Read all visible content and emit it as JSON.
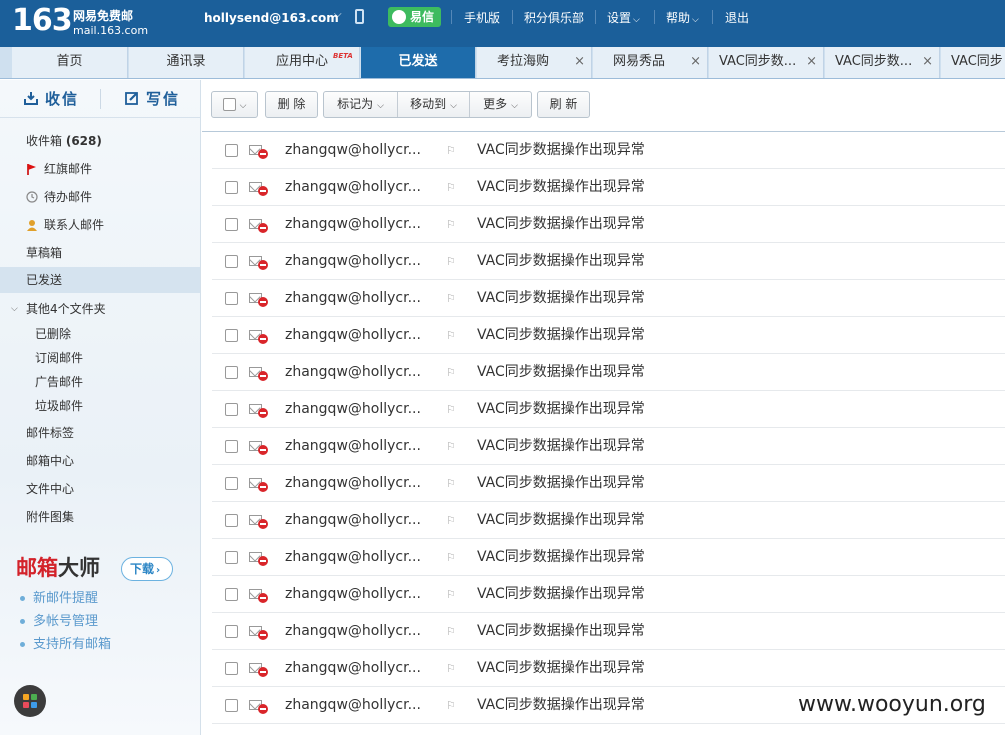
{
  "brand": {
    "logo_number": "163",
    "name": "网易免费邮",
    "domain": "mail.163.com"
  },
  "topbar": {
    "account": "hollysend@163.com",
    "yixin": "易信",
    "links": [
      "手机版",
      "积分俱乐部",
      "设置",
      "帮助",
      "退出"
    ]
  },
  "tabs": [
    {
      "label": "首页"
    },
    {
      "label": "通讯录"
    },
    {
      "label": "应用中心",
      "badge": "BETA"
    },
    {
      "label": "已发送",
      "active": true
    },
    {
      "label": "考拉海购"
    },
    {
      "label": "网易秀品"
    },
    {
      "label": "VAC同步数..."
    },
    {
      "label": "VAC同步数..."
    },
    {
      "label": "VAC同步"
    }
  ],
  "sidebar": {
    "receive": "收信",
    "compose": "写信",
    "inbox_label": "收件箱",
    "inbox_count": "(628)",
    "folders": [
      "红旗邮件",
      "待办邮件",
      "联系人邮件",
      "草稿箱",
      "已发送"
    ],
    "other_folders": "其他4个文件夹",
    "sub_folders": [
      "已删除",
      "订阅邮件",
      "广告邮件",
      "垃圾邮件"
    ],
    "extras": [
      "邮件标签",
      "邮箱中心",
      "文件中心",
      "附件图集"
    ],
    "promo": {
      "title_red": "邮箱",
      "title_dark": "大师",
      "download": "下载",
      "features": [
        "新邮件提醒",
        "多帐号管理",
        "支持所有邮箱"
      ]
    }
  },
  "toolbar": {
    "delete": "删 除",
    "mark_as": "标记为",
    "move_to": "移动到",
    "more": "更多",
    "refresh": "刷 新"
  },
  "mails": [
    {
      "to": "zhangqw@hollycr...",
      "subject": "VAC同步数据操作出现异常"
    },
    {
      "to": "zhangqw@hollycr...",
      "subject": "VAC同步数据操作出现异常"
    },
    {
      "to": "zhangqw@hollycr...",
      "subject": "VAC同步数据操作出现异常"
    },
    {
      "to": "zhangqw@hollycr...",
      "subject": "VAC同步数据操作出现异常"
    },
    {
      "to": "zhangqw@hollycr...",
      "subject": "VAC同步数据操作出现异常"
    },
    {
      "to": "zhangqw@hollycr...",
      "subject": "VAC同步数据操作出现异常"
    },
    {
      "to": "zhangqw@hollycr...",
      "subject": "VAC同步数据操作出现异常"
    },
    {
      "to": "zhangqw@hollycr...",
      "subject": "VAC同步数据操作出现异常"
    },
    {
      "to": "zhangqw@hollycr...",
      "subject": "VAC同步数据操作出现异常"
    },
    {
      "to": "zhangqw@hollycr...",
      "subject": "VAC同步数据操作出现异常"
    },
    {
      "to": "zhangqw@hollycr...",
      "subject": "VAC同步数据操作出现异常"
    },
    {
      "to": "zhangqw@hollycr...",
      "subject": "VAC同步数据操作出现异常"
    },
    {
      "to": "zhangqw@hollycr...",
      "subject": "VAC同步数据操作出现异常"
    },
    {
      "to": "zhangqw@hollycr...",
      "subject": "VAC同步数据操作出现异常"
    },
    {
      "to": "zhangqw@hollycr...",
      "subject": "VAC同步数据操作出现异常"
    },
    {
      "to": "zhangqw@hollycr...",
      "subject": "VAC同步数据操作出现异常"
    }
  ],
  "watermark": "www.wooyun.org",
  "colors": {
    "topbar": "#1b5f9a",
    "active_tab": "#1e6cab",
    "promo_red": "#d3222a",
    "fail_red": "#d9252a"
  }
}
